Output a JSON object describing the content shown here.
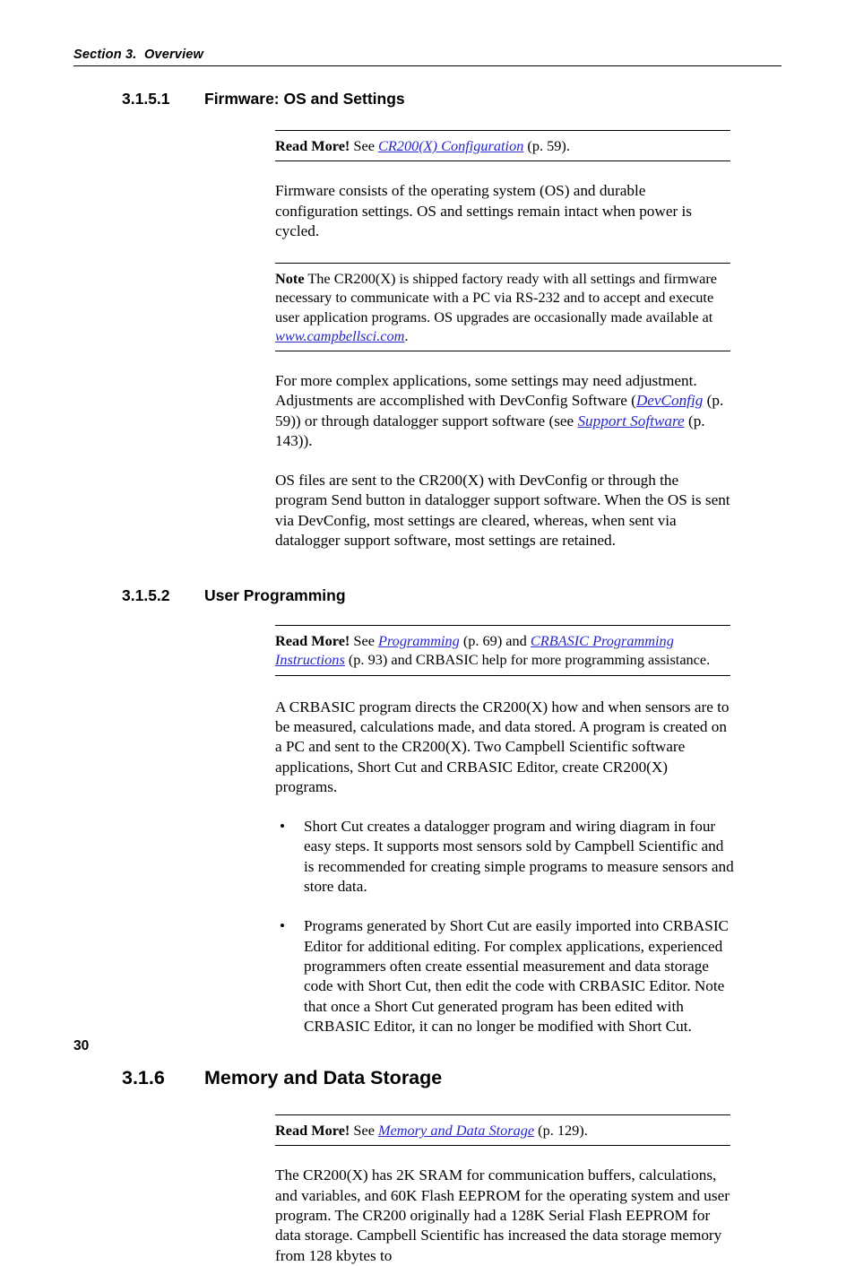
{
  "header": {
    "running_head": "Section 3.  Overview"
  },
  "footer": {
    "page_number": "30"
  },
  "link_color": "#2626CC",
  "sections": {
    "s3151": {
      "number": "3.1.5.1",
      "title": "Firmware: OS and Settings",
      "read_more": {
        "lead": "Read More!",
        "text_before": " See ",
        "link": "CR200(X) Configuration",
        "text_after": " (p. 59)."
      },
      "para1": "Firmware consists of the operating system (OS) and durable configuration settings. OS and settings remain intact when power is cycled.",
      "note": {
        "lead": "Note",
        "text_before": "  The CR200(X) is shipped factory ready with all settings and firmware necessary to communicate with a PC via RS-232 and to accept and execute user application programs. OS upgrades are occasionally made available at ",
        "link": "www.campbellsci.com",
        "text_after": "."
      },
      "para2_a": "For more complex applications, some settings may need adjustment. Adjustments are accomplished with DevConfig Software (",
      "para2_link1": "DevConfig",
      "para2_b": " (p. 59)) or through datalogger support software (see ",
      "para2_link2": "Support Software",
      "para2_c": " (p. 143)).",
      "para3": "OS files are sent to the CR200(X) with DevConfig or through the program Send button in datalogger support software. When the OS is sent via DevConfig, most settings are cleared, whereas, when sent via datalogger support software, most settings are retained."
    },
    "s3152": {
      "number": "3.1.5.2",
      "title": "User Programming",
      "read_more": {
        "lead": "Read More!",
        "text_before": " See ",
        "link1": "Programming",
        "text_mid": " (p. 69) and ",
        "link2": "CRBASIC Programming Instructions",
        "text_after": " (p. 93) and CRBASIC help for more programming assistance."
      },
      "para1": "A CRBASIC program directs the CR200(X) how and when sensors are to be measured, calculations made, and data stored. A program is created on a PC and sent to the CR200(X). Two Campbell Scientific software applications, Short Cut and CRBASIC Editor, create CR200(X) programs.",
      "bullets": [
        "Short Cut creates a datalogger program and wiring diagram in four easy steps. It supports most sensors sold by Campbell Scientific and is recommended for creating simple programs to measure sensors and store data.",
        "Programs generated by Short Cut are easily imported into CRBASIC Editor for additional editing. For complex applications, experienced programmers often create essential measurement and data storage code with Short Cut, then edit the code with CRBASIC Editor. Note that once a Short Cut generated program has been edited with CRBASIC Editor, it can no longer be modified with Short Cut."
      ],
      "bullet_glyph": "•"
    },
    "s316": {
      "number": "3.1.6",
      "title": "Memory and Data Storage",
      "read_more": {
        "lead": "Read More!",
        "text_before": " See ",
        "link": "Memory and Data Storage",
        "text_after": " (p. 129)."
      },
      "para1": "The CR200(X) has 2K SRAM for communication buffers, calculations, and variables, and 60K Flash EEPROM for the operating system and user program. The CR200 originally had a 128K Serial Flash EEPROM for data storage. Campbell Scientific has increased the data storage memory from 128 kbytes to"
    }
  }
}
